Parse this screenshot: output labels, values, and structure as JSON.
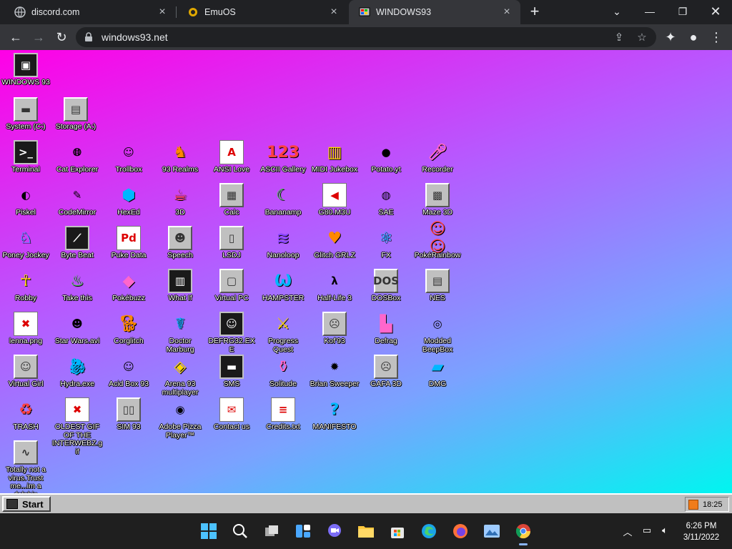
{
  "browser": {
    "tabs": [
      {
        "title": "discord.com"
      },
      {
        "title": "EmuOS"
      },
      {
        "title": "WINDOWS93"
      }
    ],
    "url": "windows93.net"
  },
  "desktop": {
    "icons": [
      {
        "label": "WINDOWS 93",
        "icon": "computer-icon"
      },
      {
        "label": "System (C:)",
        "icon": "drive-icon"
      },
      {
        "label": "Storage (A:)",
        "icon": "floppy-drive-icon"
      },
      {
        "label": "Terminal",
        "icon": "terminal-icon"
      },
      {
        "label": "Cat Explorer",
        "icon": "globe-cat-icon"
      },
      {
        "label": "Trollbox",
        "icon": "chat-icon"
      },
      {
        "label": "93 Realms",
        "icon": "knight-icon"
      },
      {
        "label": "ANSI Love",
        "icon": "letter-a-icon"
      },
      {
        "label": "ASCII Gallery",
        "icon": "numbers-icon"
      },
      {
        "label": "MIDI Jukebox",
        "icon": "piano-icon"
      },
      {
        "label": "Potato.yt",
        "icon": "potato-icon"
      },
      {
        "label": "Recorder",
        "icon": "microphone-icon"
      },
      {
        "label": "Piskel",
        "icon": "palette-icon"
      },
      {
        "label": "CodeMirror",
        "icon": "code-icon"
      },
      {
        "label": "HexEd",
        "icon": "cube-icon"
      },
      {
        "label": "3D",
        "icon": "teapot-icon"
      },
      {
        "label": "Calc",
        "icon": "calculator-icon"
      },
      {
        "label": "Bananamp",
        "icon": "banana-icon"
      },
      {
        "label": "G80.M3U",
        "icon": "speaker-icon"
      },
      {
        "label": "SAE",
        "icon": "ball-icon"
      },
      {
        "label": "Maze 3D",
        "icon": "maze-icon"
      },
      {
        "label": "Poney Jockey",
        "icon": "pony-icon"
      },
      {
        "label": "Byte Beat",
        "icon": "waveform-icon"
      },
      {
        "label": "Puke Data",
        "icon": "pd-icon"
      },
      {
        "label": "Speech",
        "icon": "face-icon"
      },
      {
        "label": "LSDJ",
        "icon": "gameboy-icon"
      },
      {
        "label": "Nanoloop",
        "icon": "wave-icon"
      },
      {
        "label": "Glitch GRLZ",
        "icon": "lips-icon"
      },
      {
        "label": "FX",
        "icon": "atom-icon"
      },
      {
        "label": "PokéRainbow",
        "icon": "pixel-people-icon"
      },
      {
        "label": "Robby",
        "icon": "stick-figure-icon"
      },
      {
        "label": "Take this",
        "icon": "fire-man-icon"
      },
      {
        "label": "Pokébuzz",
        "icon": "bag-icon"
      },
      {
        "label": "What If",
        "icon": "graph-icon"
      },
      {
        "label": "Virtual PC",
        "icon": "window-icon"
      },
      {
        "label": "HAMPSTER",
        "icon": "hamster-icon"
      },
      {
        "label": "Half-Life 3",
        "icon": "lambda-icon"
      },
      {
        "label": "DOSBox",
        "icon": "dosbox-icon"
      },
      {
        "label": "NES",
        "icon": "console-icon"
      },
      {
        "label": "lenna.png",
        "icon": "image-file-icon"
      },
      {
        "label": "Star Wars.avi",
        "icon": "yoda-icon"
      },
      {
        "label": "Corglitch",
        "icon": "corgi-icon"
      },
      {
        "label": "Doctor Marburg",
        "icon": "doctor-icon"
      },
      {
        "label": "DEFRG32.EXE",
        "icon": "monitor-face-icon"
      },
      {
        "label": "Progress Quest",
        "icon": "swords-icon"
      },
      {
        "label": "Kof'93",
        "icon": "fighter-icon"
      },
      {
        "label": "Defrag",
        "icon": "defrag-icon"
      },
      {
        "label": "Modded BeepBox",
        "icon": "ring-icon"
      },
      {
        "label": "Virtual Girl",
        "icon": "girl-face-icon"
      },
      {
        "label": "Hydra.exe",
        "icon": "hydra-icon"
      },
      {
        "label": "Acid Box 93",
        "icon": "smiley-icon"
      },
      {
        "label": "Arena 93 multiplayer",
        "icon": "iso-cube-icon"
      },
      {
        "label": "SMS",
        "icon": "sms-console-icon"
      },
      {
        "label": "Solitude",
        "icon": "bottle-icon"
      },
      {
        "label": "Brian Sweeper",
        "icon": "mine-icon"
      },
      {
        "label": "GAFA 3D",
        "icon": "doom-face-icon"
      },
      {
        "label": "DMG",
        "icon": "dmg-icon"
      },
      {
        "label": "TRASH",
        "icon": "trash-icon"
      },
      {
        "label": "OLDEST GIF OF THE INTERWEBZ.gif",
        "icon": "gif-file-icon"
      },
      {
        "label": "SIM 93",
        "icon": "book-icon"
      },
      {
        "label": "Adobe Pizza Player™",
        "icon": "pizza-icon"
      },
      {
        "label": "Contact us",
        "icon": "mail-icon"
      },
      {
        "label": "Credits.txt",
        "icon": "text-file-icon"
      },
      {
        "label": "MANIFESTO",
        "icon": "question-icon"
      },
      {
        "label": "Totally not a virus.Trust me...im a dolphin",
        "icon": "dolphin-icon"
      }
    ]
  },
  "w93_taskbar": {
    "start_label": "Start",
    "time": "18:25"
  },
  "os_taskbar": {
    "time": "6:26 PM",
    "date": "3/11/2022"
  }
}
